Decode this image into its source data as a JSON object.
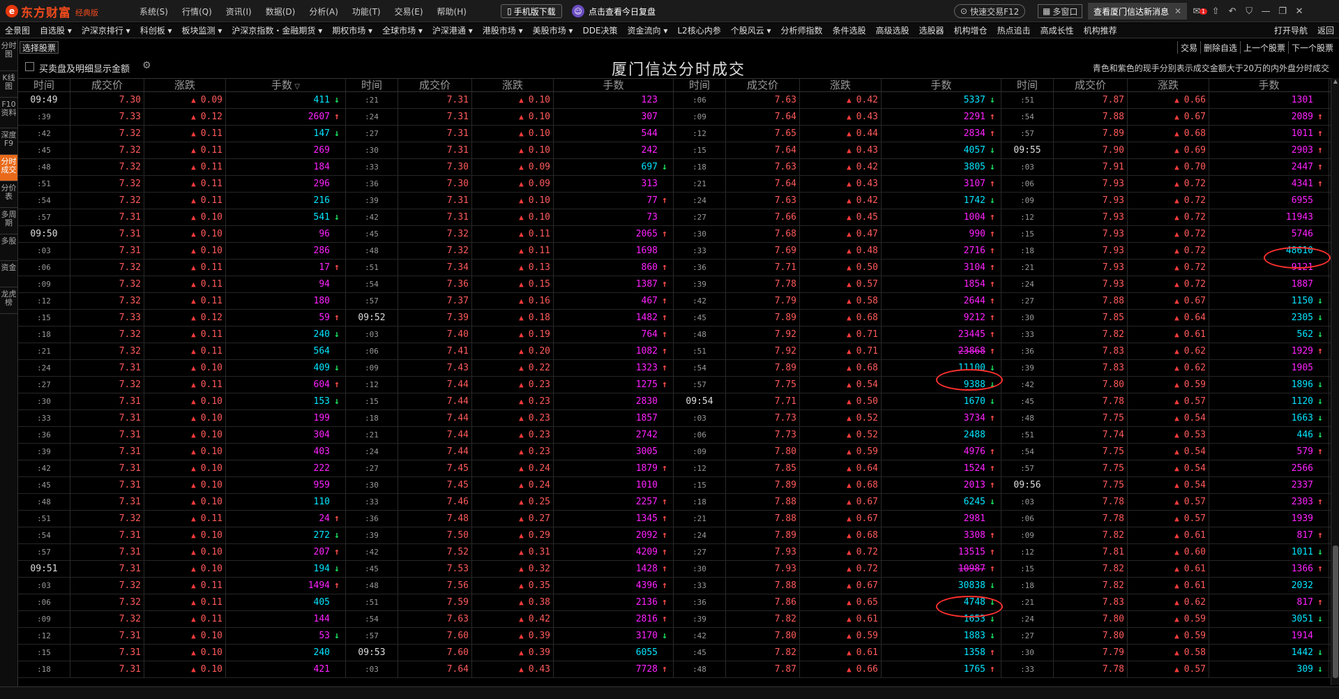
{
  "app": {
    "brand": "东方财富",
    "brand_tag": "经典版",
    "logo_glyph": "e"
  },
  "menu": [
    "系统(S)",
    "行情(Q)",
    "资讯(I)",
    "数据(D)",
    "分析(A)",
    "功能(T)",
    "交易(E)",
    "帮助(H)"
  ],
  "top": {
    "mobile_download": "手机版下载",
    "review": "点击查看今日复盘",
    "quick_trade": "快速交易F12",
    "multi_window": "多窗口",
    "news": "查看厦门信达新消息",
    "mail_badge": "1"
  },
  "nav": [
    "全景图",
    "自选股 ▾",
    "沪深京排行 ▾",
    "科创板 ▾",
    "板块监测 ▾",
    "沪深京指数・金融期货 ▾",
    "期权市场 ▾",
    "全球市场 ▾",
    "沪深港通 ▾",
    "港股市场 ▾",
    "美股市场 ▾",
    "DDE决策",
    "资金流向 ▾",
    "L2核心内参",
    "个股风云 ▾",
    "分析师指数",
    "条件选股",
    "高级选股",
    "选股器",
    "机构增仓",
    "热点追击",
    "高成长性",
    "机构推荐",
    "打开导航",
    "返回"
  ],
  "sidebar": [
    "分时图",
    "K线图",
    "F10资料",
    "深度F9",
    "分时成交",
    "分价表",
    "多周期",
    "多股",
    "资金",
    "龙虎榜"
  ],
  "toolbar": {
    "choose_stock": "选择股票",
    "trade": "交易",
    "delete_watch": "删除自选",
    "prev_stock": "上一个股票",
    "next_stock": "下一个股票"
  },
  "options": {
    "show_amount_label": "买卖盘及明细显示金额"
  },
  "title": "厦门信达分时成交",
  "legend_note": "青色和紫色的现手分别表示成交金额大于20万的内外盘分时成交",
  "headers": [
    "时间",
    "成交价",
    "涨跌",
    "手数"
  ],
  "colors": {
    "up": "#ff5a5a",
    "down_arrow": "#19e060",
    "cyan": "#00e5ff",
    "magenta": "#ff22ff",
    "active_tab": "#e86a1a",
    "highlight_oval": "#ff3030"
  },
  "columns": [
    [
      [
        "09:49",
        "7.30",
        "0.09",
        "411",
        "c",
        "d"
      ],
      [
        ":39",
        "7.33",
        "0.12",
        "2607",
        "m",
        "u"
      ],
      [
        ":42",
        "7.32",
        "0.11",
        "147",
        "c",
        "d"
      ],
      [
        ":45",
        "7.32",
        "0.11",
        "269",
        "m",
        ""
      ],
      [
        ":48",
        "7.32",
        "0.11",
        "184",
        "m",
        ""
      ],
      [
        ":51",
        "7.32",
        "0.11",
        "296",
        "m",
        ""
      ],
      [
        ":54",
        "7.32",
        "0.11",
        "216",
        "c",
        ""
      ],
      [
        ":57",
        "7.31",
        "0.10",
        "541",
        "c",
        "d"
      ],
      [
        "09:50",
        "7.31",
        "0.10",
        "96",
        "m",
        ""
      ],
      [
        ":03",
        "7.31",
        "0.10",
        "286",
        "m",
        ""
      ],
      [
        ":06",
        "7.32",
        "0.11",
        "17",
        "m",
        "u"
      ],
      [
        ":09",
        "7.32",
        "0.11",
        "94",
        "m",
        ""
      ],
      [
        ":12",
        "7.32",
        "0.11",
        "180",
        "m",
        ""
      ],
      [
        ":15",
        "7.33",
        "0.12",
        "59",
        "m",
        "u"
      ],
      [
        ":18",
        "7.32",
        "0.11",
        "240",
        "c",
        "d"
      ],
      [
        ":21",
        "7.32",
        "0.11",
        "564",
        "c",
        ""
      ],
      [
        ":24",
        "7.31",
        "0.10",
        "409",
        "c",
        "d"
      ],
      [
        ":27",
        "7.32",
        "0.11",
        "604",
        "m",
        "u"
      ],
      [
        ":30",
        "7.31",
        "0.10",
        "153",
        "c",
        "d"
      ],
      [
        ":33",
        "7.31",
        "0.10",
        "199",
        "m",
        ""
      ],
      [
        ":36",
        "7.31",
        "0.10",
        "304",
        "m",
        ""
      ],
      [
        ":39",
        "7.31",
        "0.10",
        "403",
        "m",
        ""
      ],
      [
        ":42",
        "7.31",
        "0.10",
        "222",
        "m",
        ""
      ],
      [
        ":45",
        "7.31",
        "0.10",
        "959",
        "m",
        ""
      ],
      [
        ":48",
        "7.31",
        "0.10",
        "110",
        "c",
        ""
      ],
      [
        ":51",
        "7.32",
        "0.11",
        "24",
        "m",
        "u"
      ],
      [
        ":54",
        "7.31",
        "0.10",
        "272",
        "c",
        "d"
      ],
      [
        ":57",
        "7.31",
        "0.10",
        "207",
        "m",
        "u"
      ],
      [
        "09:51",
        "7.31",
        "0.10",
        "194",
        "c",
        "d"
      ],
      [
        ":03",
        "7.32",
        "0.11",
        "1494",
        "m",
        "u"
      ],
      [
        ":06",
        "7.32",
        "0.11",
        "405",
        "c",
        ""
      ],
      [
        ":09",
        "7.32",
        "0.11",
        "144",
        "m",
        ""
      ],
      [
        ":12",
        "7.31",
        "0.10",
        "53",
        "m",
        "d"
      ],
      [
        ":15",
        "7.31",
        "0.10",
        "240",
        "c",
        ""
      ],
      [
        ":18",
        "7.31",
        "0.10",
        "421",
        "m",
        ""
      ]
    ],
    [
      [
        ":21",
        "7.31",
        "0.10",
        "123",
        "m",
        ""
      ],
      [
        ":24",
        "7.31",
        "0.10",
        "307",
        "m",
        ""
      ],
      [
        ":27",
        "7.31",
        "0.10",
        "544",
        "m",
        ""
      ],
      [
        ":30",
        "7.31",
        "0.10",
        "242",
        "m",
        ""
      ],
      [
        ":33",
        "7.30",
        "0.09",
        "697",
        "c",
        "d"
      ],
      [
        ":36",
        "7.30",
        "0.09",
        "313",
        "m",
        ""
      ],
      [
        ":39",
        "7.31",
        "0.10",
        "77",
        "m",
        "u"
      ],
      [
        ":42",
        "7.31",
        "0.10",
        "73",
        "m",
        ""
      ],
      [
        ":45",
        "7.32",
        "0.11",
        "2065",
        "m",
        "u"
      ],
      [
        ":48",
        "7.32",
        "0.11",
        "1698",
        "m",
        ""
      ],
      [
        ":51",
        "7.34",
        "0.13",
        "860",
        "m",
        "u"
      ],
      [
        ":54",
        "7.36",
        "0.15",
        "1387",
        "m",
        "u"
      ],
      [
        ":57",
        "7.37",
        "0.16",
        "467",
        "m",
        "u"
      ],
      [
        "09:52",
        "7.39",
        "0.18",
        "1482",
        "m",
        "u"
      ],
      [
        ":03",
        "7.40",
        "0.19",
        "764",
        "m",
        "u"
      ],
      [
        ":06",
        "7.41",
        "0.20",
        "1082",
        "m",
        "u"
      ],
      [
        ":09",
        "7.43",
        "0.22",
        "1323",
        "m",
        "u"
      ],
      [
        ":12",
        "7.44",
        "0.23",
        "1275",
        "m",
        "u"
      ],
      [
        ":15",
        "7.44",
        "0.23",
        "2830",
        "m",
        ""
      ],
      [
        ":18",
        "7.44",
        "0.23",
        "1857",
        "m",
        ""
      ],
      [
        ":21",
        "7.44",
        "0.23",
        "2742",
        "m",
        ""
      ],
      [
        ":24",
        "7.44",
        "0.23",
        "3005",
        "m",
        ""
      ],
      [
        ":27",
        "7.45",
        "0.24",
        "1879",
        "m",
        "u"
      ],
      [
        ":30",
        "7.45",
        "0.24",
        "1010",
        "m",
        ""
      ],
      [
        ":33",
        "7.46",
        "0.25",
        "2257",
        "m",
        "u"
      ],
      [
        ":36",
        "7.48",
        "0.27",
        "1345",
        "m",
        "u"
      ],
      [
        ":39",
        "7.50",
        "0.29",
        "2092",
        "m",
        "u"
      ],
      [
        ":42",
        "7.52",
        "0.31",
        "4209",
        "m",
        "u"
      ],
      [
        ":45",
        "7.53",
        "0.32",
        "1428",
        "m",
        "u"
      ],
      [
        ":48",
        "7.56",
        "0.35",
        "4396",
        "m",
        "u"
      ],
      [
        ":51",
        "7.59",
        "0.38",
        "2136",
        "m",
        "u"
      ],
      [
        ":54",
        "7.63",
        "0.42",
        "2816",
        "m",
        "u"
      ],
      [
        ":57",
        "7.60",
        "0.39",
        "3170",
        "m",
        "d"
      ],
      [
        "09:53",
        "7.60",
        "0.39",
        "6055",
        "c",
        ""
      ],
      [
        ":03",
        "7.64",
        "0.43",
        "7728",
        "m",
        "u"
      ]
    ],
    [
      [
        ":06",
        "7.63",
        "0.42",
        "5337",
        "c",
        "d"
      ],
      [
        ":09",
        "7.64",
        "0.43",
        "2291",
        "m",
        "u"
      ],
      [
        ":12",
        "7.65",
        "0.44",
        "2834",
        "m",
        "u"
      ],
      [
        ":15",
        "7.64",
        "0.43",
        "4057",
        "c",
        "d"
      ],
      [
        ":18",
        "7.63",
        "0.42",
        "3805",
        "c",
        "d"
      ],
      [
        ":21",
        "7.64",
        "0.43",
        "3107",
        "m",
        "u"
      ],
      [
        ":24",
        "7.63",
        "0.42",
        "1742",
        "c",
        "d"
      ],
      [
        ":27",
        "7.66",
        "0.45",
        "1004",
        "m",
        "u"
      ],
      [
        ":30",
        "7.68",
        "0.47",
        "990",
        "m",
        "u"
      ],
      [
        ":33",
        "7.69",
        "0.48",
        "2716",
        "m",
        "u"
      ],
      [
        ":36",
        "7.71",
        "0.50",
        "3104",
        "m",
        "u"
      ],
      [
        ":39",
        "7.78",
        "0.57",
        "1854",
        "m",
        "u"
      ],
      [
        ":42",
        "7.79",
        "0.58",
        "2644",
        "m",
        "u"
      ],
      [
        ":45",
        "7.89",
        "0.68",
        "9212",
        "m",
        "u"
      ],
      [
        ":48",
        "7.92",
        "0.71",
        "23445",
        "m",
        "u"
      ],
      [
        ":51",
        "7.92",
        "0.71",
        "23868",
        "m",
        "u"
      ],
      [
        ":54",
        "7.89",
        "0.68",
        "11100",
        "c",
        "d"
      ],
      [
        ":57",
        "7.75",
        "0.54",
        "9388",
        "c",
        "d"
      ],
      [
        "09:54",
        "7.71",
        "0.50",
        "1670",
        "c",
        "d"
      ],
      [
        ":03",
        "7.73",
        "0.52",
        "3734",
        "m",
        "u"
      ],
      [
        ":06",
        "7.73",
        "0.52",
        "2488",
        "c",
        ""
      ],
      [
        ":09",
        "7.80",
        "0.59",
        "4976",
        "m",
        "u"
      ],
      [
        ":12",
        "7.85",
        "0.64",
        "1524",
        "m",
        "u"
      ],
      [
        ":15",
        "7.89",
        "0.68",
        "2013",
        "m",
        "u"
      ],
      [
        ":18",
        "7.88",
        "0.67",
        "6245",
        "c",
        "d"
      ],
      [
        ":21",
        "7.88",
        "0.67",
        "2981",
        "m",
        ""
      ],
      [
        ":24",
        "7.89",
        "0.68",
        "3308",
        "m",
        "u"
      ],
      [
        ":27",
        "7.93",
        "0.72",
        "13515",
        "m",
        "u"
      ],
      [
        ":30",
        "7.93",
        "0.72",
        "10987",
        "m",
        "u"
      ],
      [
        ":33",
        "7.88",
        "0.67",
        "30838",
        "c",
        "d"
      ],
      [
        ":36",
        "7.86",
        "0.65",
        "4748",
        "c",
        "d"
      ],
      [
        ":39",
        "7.82",
        "0.61",
        "1653",
        "c",
        "d"
      ],
      [
        ":42",
        "7.80",
        "0.59",
        "1883",
        "c",
        "d"
      ],
      [
        ":45",
        "7.82",
        "0.61",
        "1358",
        "c",
        "u"
      ],
      [
        ":48",
        "7.87",
        "0.66",
        "1765",
        "c",
        "u"
      ]
    ],
    [
      [
        ":51",
        "7.87",
        "0.66",
        "1301",
        "m",
        ""
      ],
      [
        ":54",
        "7.88",
        "0.67",
        "2089",
        "m",
        "u"
      ],
      [
        ":57",
        "7.89",
        "0.68",
        "1011",
        "m",
        "u"
      ],
      [
        "09:55",
        "7.90",
        "0.69",
        "2903",
        "m",
        "u"
      ],
      [
        ":03",
        "7.91",
        "0.70",
        "2447",
        "m",
        "u"
      ],
      [
        ":06",
        "7.93",
        "0.72",
        "4341",
        "m",
        "u"
      ],
      [
        ":09",
        "7.93",
        "0.72",
        "6955",
        "m",
        ""
      ],
      [
        ":12",
        "7.93",
        "0.72",
        "11943",
        "m",
        ""
      ],
      [
        ":15",
        "7.93",
        "0.72",
        "5746",
        "m",
        ""
      ],
      [
        ":18",
        "7.93",
        "0.72",
        "48610",
        "c",
        ""
      ],
      [
        ":21",
        "7.93",
        "0.72",
        "9121",
        "m",
        ""
      ],
      [
        ":24",
        "7.93",
        "0.72",
        "1887",
        "m",
        ""
      ],
      [
        ":27",
        "7.88",
        "0.67",
        "1150",
        "c",
        "d"
      ],
      [
        ":30",
        "7.85",
        "0.64",
        "2305",
        "c",
        "d"
      ],
      [
        ":33",
        "7.82",
        "0.61",
        "562",
        "c",
        "d"
      ],
      [
        ":36",
        "7.83",
        "0.62",
        "1929",
        "m",
        "u"
      ],
      [
        ":39",
        "7.83",
        "0.62",
        "1905",
        "m",
        ""
      ],
      [
        ":42",
        "7.80",
        "0.59",
        "1896",
        "c",
        "d"
      ],
      [
        ":45",
        "7.78",
        "0.57",
        "1120",
        "c",
        "d"
      ],
      [
        ":48",
        "7.75",
        "0.54",
        "1663",
        "c",
        "d"
      ],
      [
        ":51",
        "7.74",
        "0.53",
        "446",
        "c",
        "d"
      ],
      [
        ":54",
        "7.75",
        "0.54",
        "579",
        "m",
        "u"
      ],
      [
        ":57",
        "7.75",
        "0.54",
        "2566",
        "m",
        ""
      ],
      [
        "09:56",
        "7.75",
        "0.54",
        "2337",
        "m",
        ""
      ],
      [
        ":03",
        "7.78",
        "0.57",
        "2303",
        "m",
        "u"
      ],
      [
        ":06",
        "7.78",
        "0.57",
        "1939",
        "m",
        ""
      ],
      [
        ":09",
        "7.82",
        "0.61",
        "817",
        "m",
        "u"
      ],
      [
        ":12",
        "7.81",
        "0.60",
        "1011",
        "c",
        "d"
      ],
      [
        ":15",
        "7.82",
        "0.61",
        "1366",
        "m",
        "u"
      ],
      [
        ":18",
        "7.82",
        "0.61",
        "2032",
        "c",
        ""
      ],
      [
        ":21",
        "7.83",
        "0.62",
        "817",
        "m",
        "u"
      ],
      [
        ":24",
        "7.80",
        "0.59",
        "3051",
        "c",
        "d"
      ],
      [
        ":27",
        "7.80",
        "0.59",
        "1914",
        "m",
        ""
      ],
      [
        ":30",
        "7.79",
        "0.58",
        "1442",
        "c",
        "d"
      ],
      [
        ":33",
        "7.78",
        "0.57",
        "309",
        "c",
        "d"
      ]
    ]
  ],
  "highlights": [
    {
      "column": 2,
      "row": 16
    },
    {
      "column": 2,
      "row": 29
    },
    {
      "column": 3,
      "row": 9
    }
  ]
}
